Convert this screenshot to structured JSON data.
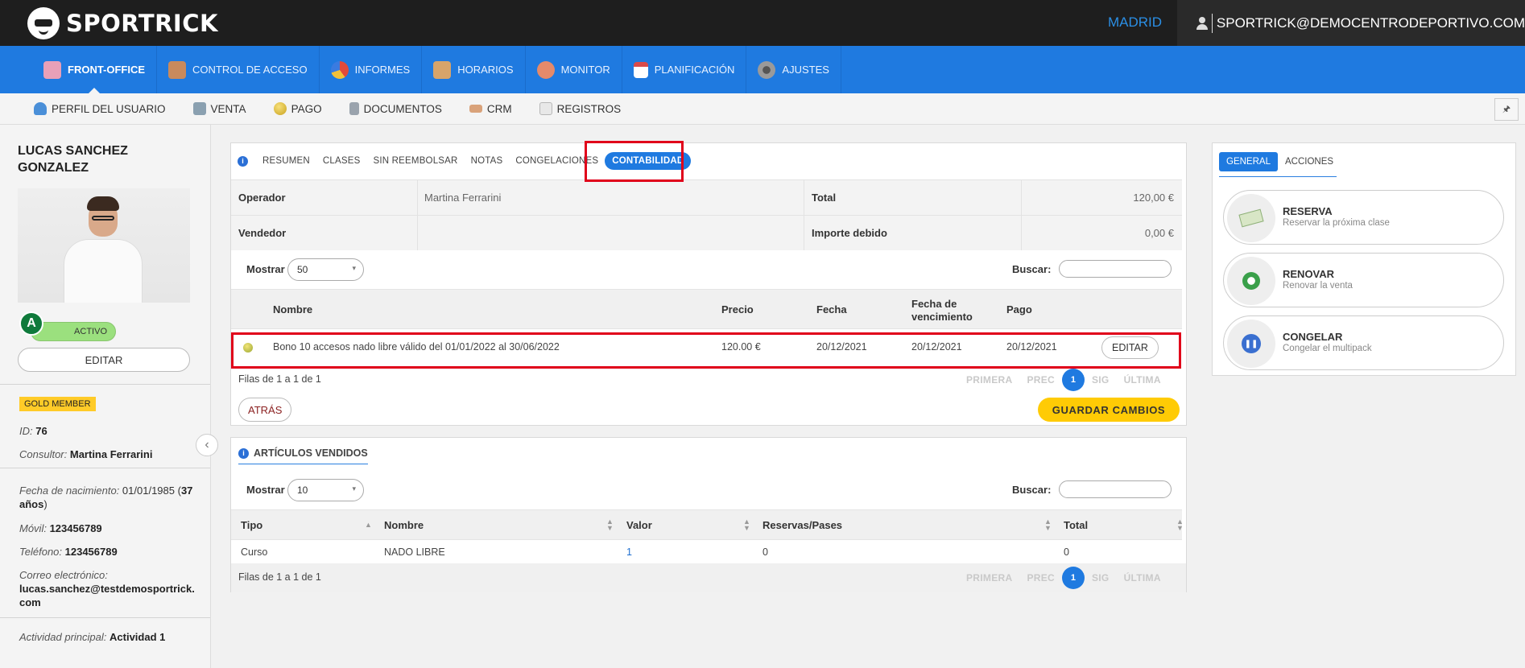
{
  "topbar": {
    "brand": "SPORTRICK",
    "city": "MADRID",
    "user_email": "SPORTRICK@DEMOCENTRODEPORTIVO.COM"
  },
  "main_nav": [
    {
      "label": "FRONT-OFFICE",
      "active": true,
      "icon": "front-office-icon",
      "color": "#e8a0b8"
    },
    {
      "label": "CONTROL DE ACCESO",
      "active": false,
      "icon": "access-control-icon",
      "color": "#c98a5c"
    },
    {
      "label": "INFORMES",
      "active": false,
      "icon": "pie-chart-icon",
      "color": "#e24a3b"
    },
    {
      "label": "HORARIOS",
      "active": false,
      "icon": "schedule-icon",
      "color": "#d7a46a"
    },
    {
      "label": "MONITOR",
      "active": false,
      "icon": "monitor-icon",
      "color": "#e58a6a"
    },
    {
      "label": "PLANIFICACIÓN",
      "active": false,
      "icon": "calendar-icon",
      "color": "#d94b4b"
    },
    {
      "label": "AJUSTES",
      "active": false,
      "icon": "gear-icon",
      "color": "#9a9a9a"
    }
  ],
  "sub_nav": [
    {
      "label": "PERFIL DEL USUARIO",
      "icon": "user-profile-icon",
      "color": "#4a8fd8"
    },
    {
      "label": "VENTA",
      "icon": "sale-icon",
      "color": "#8aa0b0"
    },
    {
      "label": "PAGO",
      "icon": "coin-icon",
      "color": "#e5c13a"
    },
    {
      "label": "DOCUMENTOS",
      "icon": "document-icon",
      "color": "#9aa3ad"
    },
    {
      "label": "CRM",
      "icon": "handshake-icon",
      "color": "#d9a27a"
    },
    {
      "label": "REGISTROS",
      "icon": "log-icon",
      "color": "#b7b7b7"
    }
  ],
  "pin_label": "🖈",
  "profile": {
    "name": "LUCAS SANCHEZ GONZALEZ",
    "badge_letter": "A",
    "status": "ACTIVO",
    "edit_label": "EDITAR",
    "member_badge": "GOLD MEMBER",
    "id_label": "ID:",
    "id_value": "76",
    "consultant_label": "Consultor:",
    "consultant_value": "Martina Ferrarini",
    "birth_label": "Fecha de nacimiento:",
    "birth_value": "01/01/1985",
    "age_value": "37 años",
    "mobile_label": "Móvil:",
    "mobile_value": "123456789",
    "phone_label": "Teléfono:",
    "phone_value": "123456789",
    "email_label": "Correo electrónico:",
    "email_value": "lucas.sanchez@testdemosportrick.com",
    "activity_label": "Actividad principal:",
    "activity_value": "Actividad 1"
  },
  "sale_panel": {
    "tabs": [
      {
        "label": "RESUMEN",
        "active": false
      },
      {
        "label": "CLASES",
        "active": false
      },
      {
        "label": "SIN REEMBOLSAR",
        "active": false
      },
      {
        "label": "NOTAS",
        "active": false
      },
      {
        "label": "CONGELACIONES",
        "active": false
      },
      {
        "label": "CONTABILIDAD",
        "active": true
      }
    ],
    "summary": {
      "operator_label": "Operador",
      "operator_value": "Martina Ferrarini",
      "total_label": "Total",
      "total_value": "120,00 €",
      "seller_label": "Vendedor",
      "seller_value": "",
      "due_label": "Importe debido",
      "due_value": "0,00 €"
    },
    "show_label": "Mostrar",
    "show_value": "50",
    "search_label": "Buscar:",
    "columns": [
      "Nombre",
      "Precio",
      "Fecha",
      "Fecha de vencimiento",
      "Pago"
    ],
    "rows": [
      {
        "name": "Bono 10 accesos nado libre válido del 01/01/2022 al 30/06/2022",
        "price": "120.00 €",
        "date": "20/12/2021",
        "due_date": "20/12/2021",
        "payment": "20/12/2021",
        "edit_label": "EDITAR"
      }
    ],
    "pager_info": "Filas de 1 a 1 de 1",
    "pager": {
      "first": "PRIMERA",
      "prev": "PREC",
      "current": "1",
      "next": "SIG",
      "last": "ÚLTIMA"
    },
    "back_label": "ATRÁS",
    "save_label": "GUARDAR CAMBIOS"
  },
  "items_panel": {
    "title": "ARTÍCULOS VENDIDOS",
    "show_label": "Mostrar",
    "show_value": "10",
    "search_label": "Buscar:",
    "columns": [
      "Tipo",
      "Nombre",
      "Valor",
      "Reservas/Pases",
      "Total"
    ],
    "rows": [
      {
        "type": "Curso",
        "name": "NADO LIBRE",
        "value": "1",
        "bookings": "0",
        "total": "0"
      }
    ],
    "pager_info": "Filas de 1 a 1 de 1",
    "pager": {
      "first": "PRIMERA",
      "prev": "PREC",
      "current": "1",
      "next": "SIG",
      "last": "ÚLTIMA"
    }
  },
  "actions_panel": {
    "tabs": [
      {
        "label": "GENERAL",
        "active": true
      },
      {
        "label": "ACCIONES",
        "active": false
      }
    ],
    "actions": [
      {
        "title": "RESERVA",
        "subtitle": "Reservar la próxima clase",
        "icon": "booking-icon"
      },
      {
        "title": "RENOVAR",
        "subtitle": "Renovar la venta",
        "icon": "renew-icon"
      },
      {
        "title": "CONGELAR",
        "subtitle": "Congelar el multipack",
        "icon": "freeze-icon"
      }
    ]
  }
}
